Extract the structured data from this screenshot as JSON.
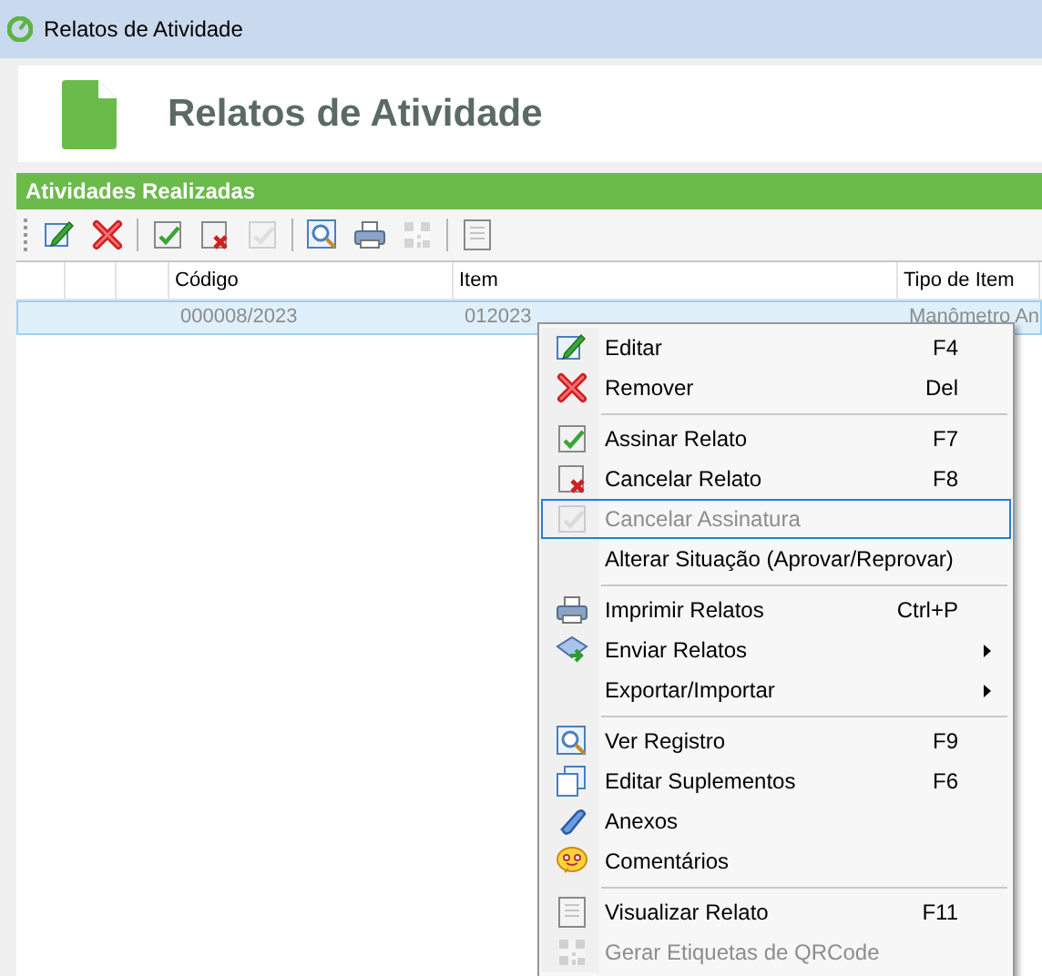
{
  "window": {
    "title": "Relatos de Atividade"
  },
  "header": {
    "title": "Relatos de Atividade"
  },
  "panel": {
    "title": "Atividades Realizadas"
  },
  "toolbar": [
    {
      "kind": "edit",
      "disabled": false
    },
    {
      "kind": "remove",
      "disabled": false
    },
    {
      "kind": "separator"
    },
    {
      "kind": "sign",
      "disabled": false
    },
    {
      "kind": "cancel",
      "disabled": false
    },
    {
      "kind": "sign",
      "disabled": true
    },
    {
      "kind": "separator"
    },
    {
      "kind": "view",
      "disabled": false
    },
    {
      "kind": "print",
      "disabled": false
    },
    {
      "kind": "qrcode",
      "disabled": true
    },
    {
      "kind": "separator"
    },
    {
      "kind": "document",
      "disabled": false
    }
  ],
  "table": {
    "columns": [
      "Código",
      "Item",
      "Tipo de Item"
    ],
    "rows": [
      {
        "cells": [
          "000008/2023",
          "012023",
          "Manômetro An"
        ],
        "selected": true
      }
    ]
  },
  "context_menu": {
    "items": [
      {
        "kind": "edit",
        "label": "Editar",
        "shortcut": "F4",
        "disabled": false,
        "highlighted": false,
        "submenu": false
      },
      {
        "kind": "remove",
        "label": "Remover",
        "shortcut": "Del",
        "disabled": false,
        "highlighted": false,
        "submenu": false
      },
      {
        "kind": "separator"
      },
      {
        "kind": "sign",
        "label": "Assinar Relato",
        "shortcut": "F7",
        "disabled": false,
        "highlighted": false,
        "submenu": false
      },
      {
        "kind": "cancel",
        "label": "Cancelar Relato",
        "shortcut": "F8",
        "disabled": false,
        "highlighted": false,
        "submenu": false
      },
      {
        "kind": "sign",
        "label": "Cancelar Assinatura",
        "disabled": true,
        "highlighted": true,
        "submenu": false
      },
      {
        "kind": "none",
        "label": "Alterar Situação (Aprovar/Reprovar)",
        "disabled": false,
        "highlighted": false,
        "submenu": false
      },
      {
        "kind": "separator"
      },
      {
        "kind": "print",
        "label": "Imprimir Relatos",
        "shortcut": "Ctrl+P",
        "disabled": false,
        "highlighted": false,
        "submenu": false
      },
      {
        "kind": "send",
        "label": "Enviar Relatos",
        "disabled": false,
        "highlighted": false,
        "submenu": true
      },
      {
        "kind": "none",
        "label": "Exportar/Importar",
        "disabled": false,
        "highlighted": false,
        "submenu": true
      },
      {
        "kind": "separator"
      },
      {
        "kind": "view",
        "label": "Ver Registro",
        "shortcut": "F9",
        "disabled": false,
        "highlighted": false,
        "submenu": false
      },
      {
        "kind": "supplement",
        "label": "Editar Suplementos",
        "shortcut": "F6",
        "disabled": false,
        "highlighted": false,
        "submenu": false
      },
      {
        "kind": "attach",
        "label": "Anexos",
        "disabled": false,
        "highlighted": false,
        "submenu": false
      },
      {
        "kind": "comment",
        "label": "Comentários",
        "disabled": false,
        "highlighted": false,
        "submenu": false
      },
      {
        "kind": "separator"
      },
      {
        "kind": "document",
        "label": "Visualizar Relato",
        "shortcut": "F11",
        "disabled": false,
        "highlighted": false,
        "submenu": false
      },
      {
        "kind": "qrcode",
        "label": "Gerar Etiquetas de QRCode",
        "disabled": true,
        "highlighted": false,
        "submenu": false
      }
    ]
  }
}
